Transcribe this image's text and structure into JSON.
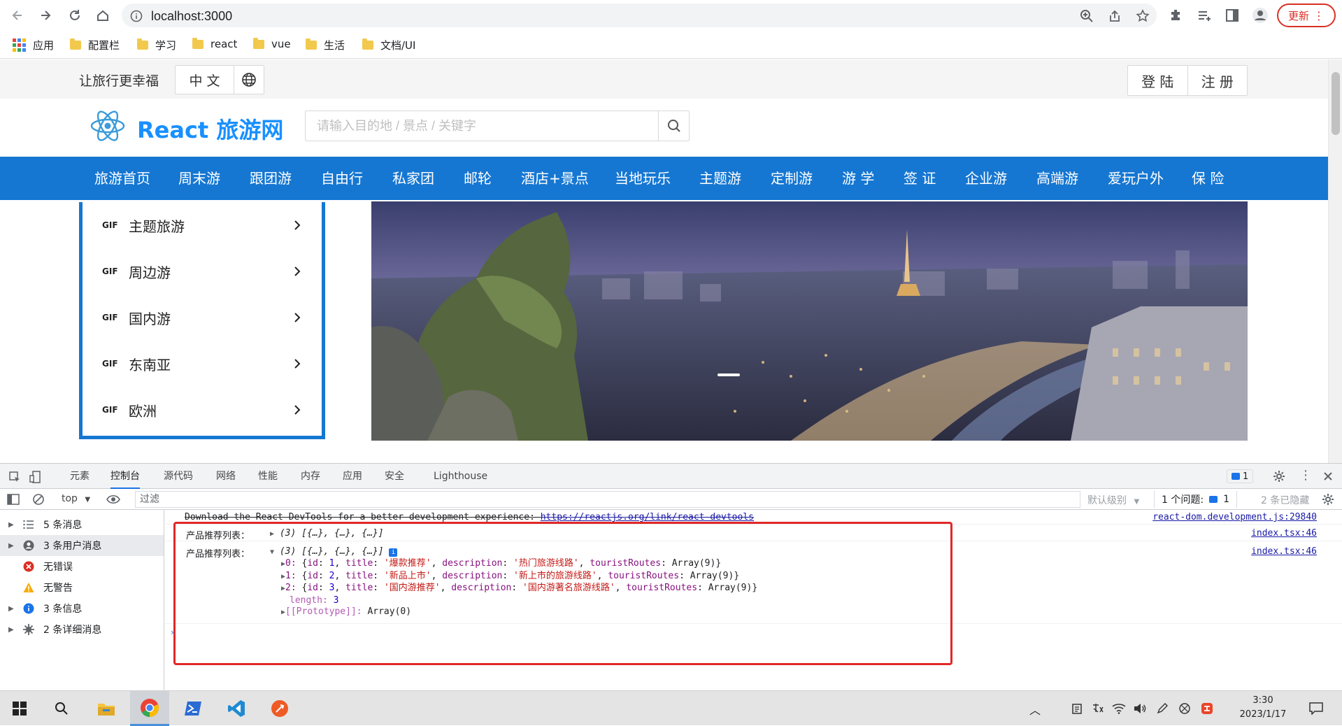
{
  "browser": {
    "url": "localhost:3000",
    "update_label": "更新",
    "bookmarks": [
      {
        "label": "应用"
      },
      {
        "label": "配置栏"
      },
      {
        "label": "学习"
      },
      {
        "label": "react"
      },
      {
        "label": "vue"
      },
      {
        "label": "生活"
      },
      {
        "label": "文档/UI"
      }
    ]
  },
  "topbar": {
    "slogan": "让旅行更幸福",
    "language": "中 文",
    "login": "登 陆",
    "register": "注 册"
  },
  "header": {
    "title": "React 旅游网",
    "search_placeholder": "请输入目的地 / 景点 / 关键字"
  },
  "menu": [
    "旅游首页",
    "周末游",
    "跟团游",
    "自由行",
    "私家团",
    "邮轮",
    "酒店+景点",
    "当地玩乐",
    "主题游",
    "定制游",
    "游 学",
    "签 证",
    "企业游",
    "高端游",
    "爱玩户外",
    "保 险"
  ],
  "side_menu": [
    {
      "badge": "GIF",
      "label": "主题旅游"
    },
    {
      "badge": "GIF",
      "label": "周边游"
    },
    {
      "badge": "GIF",
      "label": "国内游"
    },
    {
      "badge": "GIF",
      "label": "东南亚"
    },
    {
      "badge": "GIF",
      "label": "欧洲"
    }
  ],
  "devtools": {
    "tabs": [
      "元素",
      "控制台",
      "源代码",
      "网络",
      "性能",
      "内存",
      "应用",
      "安全",
      "Lighthouse"
    ],
    "active_tab": "控制台",
    "issues_badge": "1",
    "context": "top",
    "filter_placeholder": "过滤",
    "level": "默认级别",
    "issue_count_label": "1 个问题:",
    "issue_count": "1",
    "hidden_count": "2 条已隐藏",
    "sidebar": [
      {
        "label": "5 条消息",
        "icon": "list-icon"
      },
      {
        "label": "3 条用户消息",
        "icon": "user-icon"
      },
      {
        "label": "无错误",
        "icon": "error-icon"
      },
      {
        "label": "无警告",
        "icon": "warning-icon"
      },
      {
        "label": "3 条信息",
        "icon": "info-icon"
      },
      {
        "label": "2 条详细消息",
        "icon": "verbose-icon"
      }
    ],
    "logs": {
      "devtools_msg": "Download the React DevTools for a better development experience: ",
      "devtools_link": "https://reactjs.org/link/react-devtools",
      "devtools_src": "react-dom.development.js:29840",
      "log1_label": "产品推荐列表：",
      "log1_value": "(3) [{…}, {…}, {…}]",
      "log1_src": "index.tsx:46",
      "log2_label": "产品推荐列表：",
      "log2_value": "(3) [{…}, {…}, {…}]",
      "log2_src": "index.tsx:46",
      "items": [
        {
          "index": "0",
          "id": "1",
          "title": "'爆款推荐'",
          "description": "'热门旅游线路'",
          "routes": "Array(9)"
        },
        {
          "index": "1",
          "id": "2",
          "title": "'新品上市'",
          "description": "'新上市的旅游线路'",
          "routes": "Array(9)"
        },
        {
          "index": "2",
          "id": "3",
          "title": "'国内游推荐'",
          "description": "'国内游著名旅游线路'",
          "routes": "Array(9)"
        }
      ],
      "length_key": "length",
      "length_value": "3",
      "prototype_key": "[[Prototype]]",
      "prototype_value": "Array(0)"
    }
  },
  "taskbar": {
    "time": "3:30",
    "date": "2023/1/17"
  },
  "colors": {
    "brand_blue": "#1677d2",
    "title_blue": "#1890ff",
    "highlight_red": "#e12828"
  }
}
